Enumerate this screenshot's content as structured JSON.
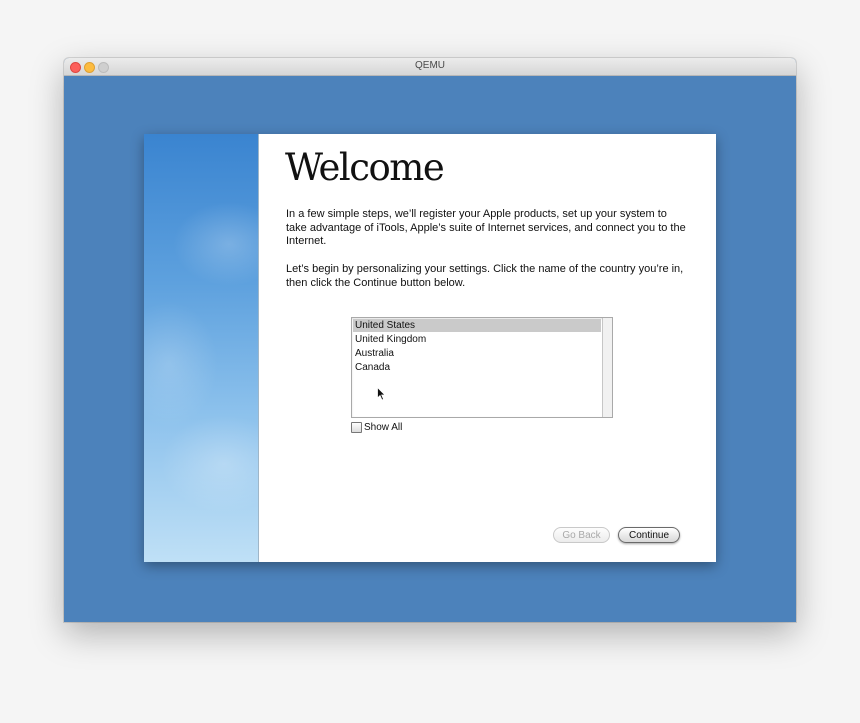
{
  "window": {
    "title": "QEMU"
  },
  "setup": {
    "heading": "Welcome",
    "intro": "In a few simple steps, we’ll register your Apple products, set up your system to take advantage of iTools, Apple’s suite of Internet services, and connect you to the Internet.",
    "instruction": "Let’s begin by personalizing your settings. Click the name of the country you’re in, then click the Continue button below.",
    "countries": [
      {
        "label": "United States",
        "selected": true
      },
      {
        "label": "United Kingdom",
        "selected": false
      },
      {
        "label": "Australia",
        "selected": false
      },
      {
        "label": "Canada",
        "selected": false
      }
    ],
    "show_all_label": "Show All",
    "show_all_checked": false,
    "go_back_label": "Go Back",
    "continue_label": "Continue"
  },
  "icons": {
    "pointer": "mouse-cursor-icon"
  },
  "colors": {
    "desktop": "#4c82bb",
    "selection": "#cacaca"
  }
}
